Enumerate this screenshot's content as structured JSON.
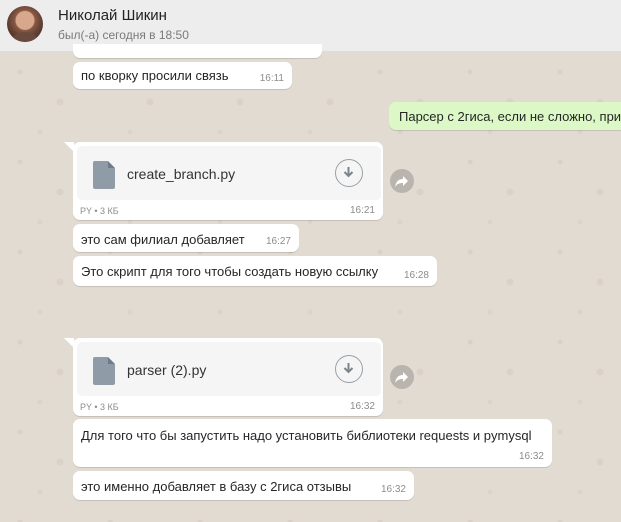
{
  "header": {
    "contact_name": "Николай Шикин",
    "status": "был(-а) сегодня в 18:50"
  },
  "messages": [
    {
      "text": "по кворку просили связь",
      "time": "16:11"
    },
    {
      "text": "Парсер с 2гиса, если не сложно, при",
      "time": ""
    },
    {
      "file": "create_branch.py",
      "meta": "PY • 3 КБ",
      "time": "16:21"
    },
    {
      "text": "это сам филиал добавляет",
      "time": "16:27"
    },
    {
      "text": "Это скрипт для того чтобы создать новую ссылку",
      "time": "16:28"
    },
    {
      "file": "parser (2).py",
      "meta": "PY • 3 КБ",
      "time": "16:32"
    },
    {
      "text": "Для того что бы запустить надо установить библиотеки requests и pymysql",
      "time": "16:32"
    },
    {
      "text": "это именно добавляет в базу  с 2гиса отзывы",
      "time": "16:32"
    }
  ],
  "icons": {
    "download": "download-icon",
    "forward": "forward-icon",
    "file": "file-icon"
  },
  "colors": {
    "outgoing_bubble": "#dcf8c6",
    "incoming_bubble": "#ffffff",
    "chat_background": "#e2dbd2",
    "header_background": "#ededed"
  }
}
